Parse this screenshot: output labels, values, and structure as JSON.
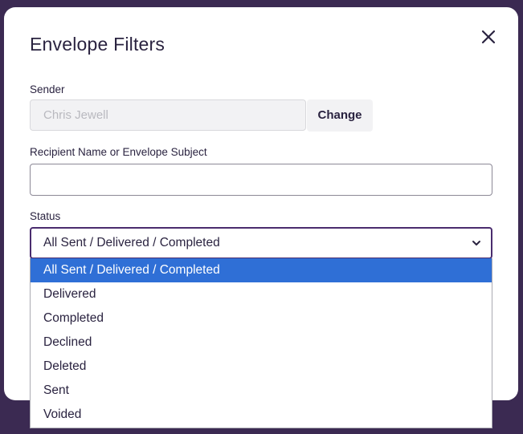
{
  "modal": {
    "title": "Envelope Filters"
  },
  "sender": {
    "label": "Sender",
    "value": "Chris Jewell",
    "change_label": "Change"
  },
  "recipient": {
    "label": "Recipient Name or Envelope Subject",
    "value": ""
  },
  "status": {
    "label": "Status",
    "selected": "All Sent / Delivered / Completed",
    "options": [
      "All Sent / Delivered / Completed",
      "Delivered",
      "Completed",
      "Declined",
      "Deleted",
      "Sent",
      "Voided"
    ]
  },
  "colors": {
    "backdrop": "#3b2a52",
    "select_border": "#4a2c6e",
    "option_highlight": "#2f6fd6"
  },
  "icons": {
    "close": "close-icon",
    "dropdown": "chevron-down-icon"
  }
}
